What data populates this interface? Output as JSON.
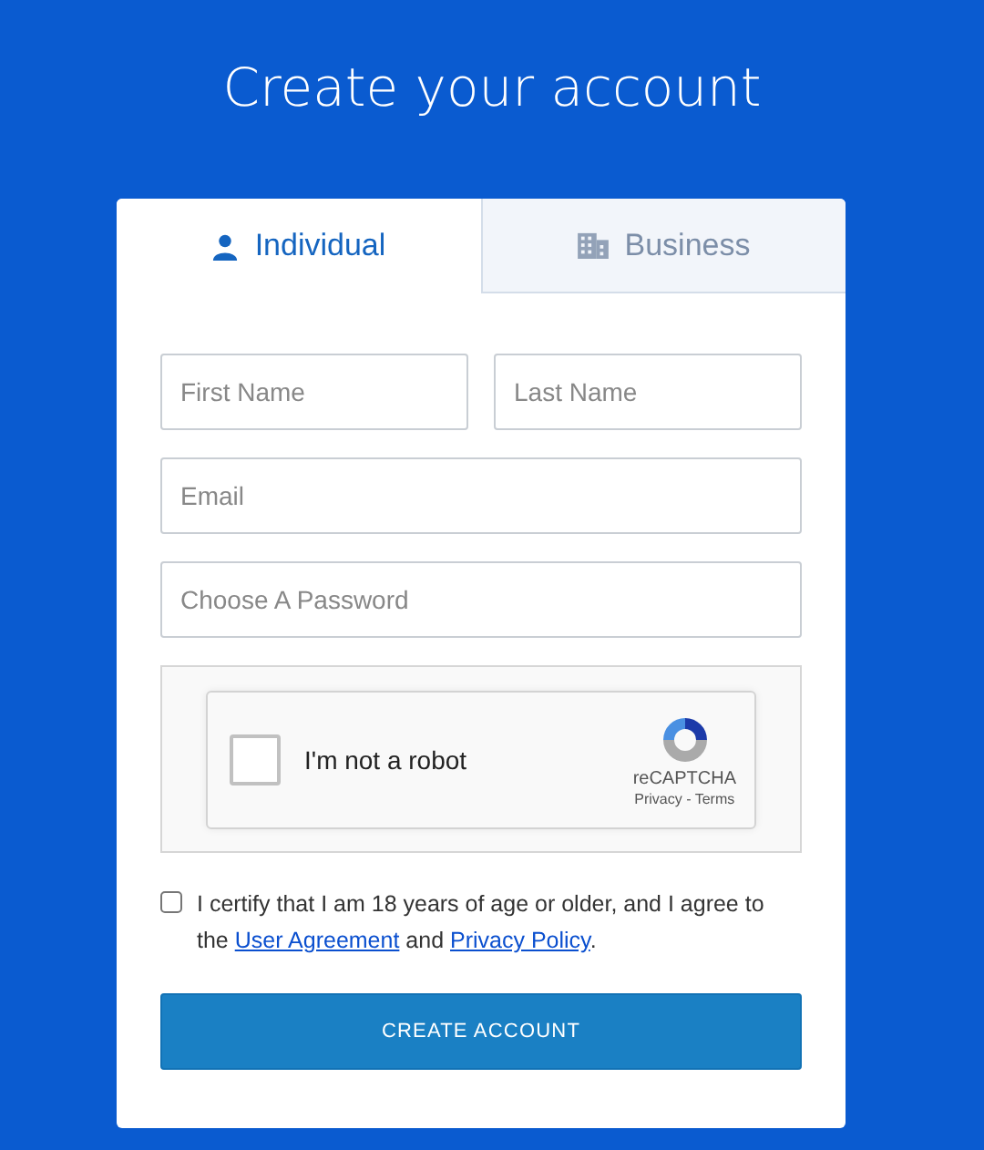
{
  "title": "Create your account",
  "tabs": [
    {
      "label": "Individual",
      "kind": "person",
      "selected": true
    },
    {
      "label": "Business",
      "kind": "building",
      "selected": false
    }
  ],
  "name_fields": [
    {
      "placeholder": "First Name"
    },
    {
      "placeholder": "Last Name"
    }
  ],
  "fields": [
    {
      "placeholder": "Email"
    },
    {
      "placeholder": "Choose A Password"
    }
  ],
  "captcha": {
    "label": "I'm not a robot",
    "checked": false,
    "brand": "reCAPTCHA",
    "privacy": "Privacy",
    "separator": " - ",
    "terms": "Terms"
  },
  "agreement": {
    "checked": false,
    "before": "I certify that I am 18 years of age or older, and I agree to the",
    "link1": "User Agreement",
    "middle": "and",
    "link2": "Privacy Policy",
    "after": "."
  },
  "submit": "CREATE ACCOUNT"
}
